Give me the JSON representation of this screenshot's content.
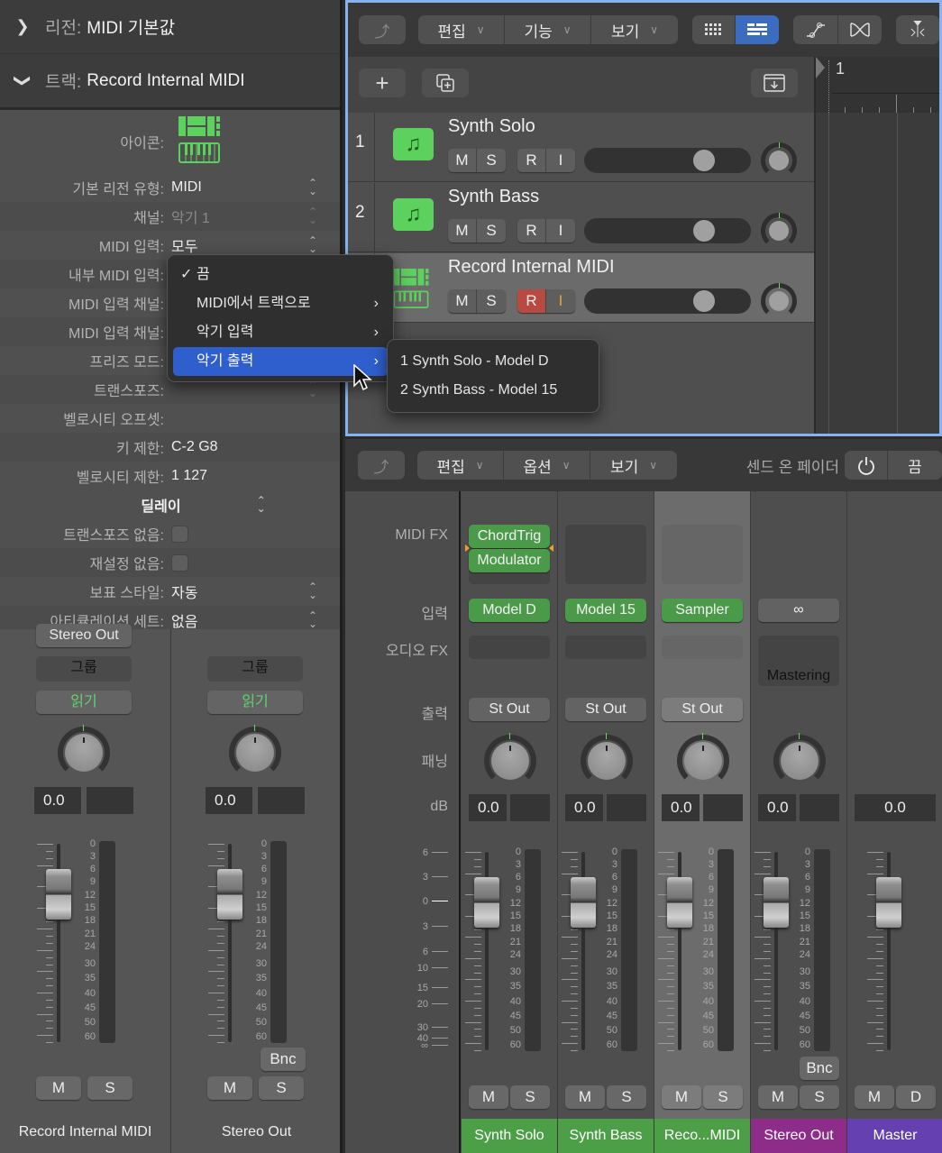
{
  "inspector": {
    "region_header": {
      "label": "리전:",
      "value": "MIDI 기본값",
      "chevron": "chevron-right-icon"
    },
    "track_header": {
      "label": "트랙:",
      "value": "Record Internal MIDI",
      "chevron": "chevron-down-icon"
    },
    "icon_label": "아이콘:",
    "rows": [
      {
        "label": "기본 리전 유형:",
        "value": "MIDI",
        "stepper": true
      },
      {
        "label": "채널:",
        "value": "악기 1",
        "stepper": true,
        "dim": true
      },
      {
        "label": "MIDI 입력:",
        "value": "모두",
        "stepper": true
      },
      {
        "label": "내부 MIDI 입력:",
        "value": ""
      },
      {
        "label": "MIDI 입력 채널:",
        "value": ""
      },
      {
        "label": "MIDI 입력 채널:",
        "value": ""
      },
      {
        "label": "프리즈 모드:",
        "value": ""
      },
      {
        "label": "트랜스포즈:",
        "value": "",
        "stepper": true,
        "dim": true
      },
      {
        "label": "벨로시티 오프셋:",
        "value": ""
      },
      {
        "label": "키 제한:",
        "value": "C-2  G8"
      },
      {
        "label": "벨로시티 제한:",
        "value": "1   127"
      }
    ],
    "delay_label": "딜레이",
    "checkbox_rows": [
      {
        "label": "트랜스포즈 없음:",
        "checked": false
      },
      {
        "label": "재설정 없음:",
        "checked": false
      }
    ],
    "bottom_rows": [
      {
        "label": "보표 스타일:",
        "value": "자동"
      },
      {
        "label": "아티큘레이션 세트:",
        "value": "없음"
      }
    ],
    "strips": [
      {
        "output": "Stereo Out",
        "group": "그룹",
        "automation": "읽기",
        "volume": "0.0",
        "peak": "",
        "mute": "M",
        "solo": "S",
        "bounce": "",
        "name": "Record Internal MIDI",
        "fader_db": 0
      },
      {
        "output": "",
        "group": "그룹",
        "automation": "읽기",
        "volume": "0.0",
        "peak": "",
        "mute": "M",
        "solo": "S",
        "bounce": "Bnc",
        "name": "Stereo Out",
        "fader_db": 0
      }
    ],
    "meter_scale": [
      "0",
      "3",
      "6",
      "9",
      "12",
      "15",
      "18",
      "21",
      "24",
      "30",
      "35",
      "40",
      "45",
      "50",
      "60"
    ]
  },
  "popup_menu": {
    "items": [
      {
        "label": "끔",
        "checked": true,
        "submenu": false
      },
      {
        "label": "MIDI에서 트랙으로",
        "checked": false,
        "submenu": true
      },
      {
        "label": "악기 입력",
        "checked": false,
        "submenu": true
      },
      {
        "label": "악기 출력",
        "checked": false,
        "submenu": true,
        "highlighted": true
      }
    ],
    "check_glyph": "✓",
    "submenu_glyph": "›",
    "submenu_items": [
      "1 Synth Solo - Model D",
      "2 Synth Bass - Model 15"
    ]
  },
  "tracks": {
    "toolbar": {
      "back_icon": "back-arrow-icon",
      "menus": [
        "편집",
        "기능",
        "보기"
      ],
      "view_buttons": [
        "grid-view-icon",
        "list-view-icon"
      ],
      "active_view": 1,
      "tools": [
        "automation-icon",
        "flex-icon"
      ],
      "snap_icon": "catch-playhead-icon"
    },
    "add_track_icon": "plus-icon",
    "duplicate_track_icon": "duplicate-icon",
    "download_icon": "download-icon",
    "ruler_bar": "1",
    "list": [
      {
        "number": "1",
        "name": "Synth Solo",
        "icon": "music-note-icon",
        "mute": "M",
        "solo": "S",
        "rec": "R",
        "input": "I",
        "rec_on": false,
        "selected": false,
        "volume_fraction": 0.75
      },
      {
        "number": "2",
        "name": "Synth Bass",
        "icon": "music-note-icon",
        "mute": "M",
        "solo": "S",
        "rec": "R",
        "input": "I",
        "rec_on": false,
        "selected": false,
        "volume_fraction": 0.75
      },
      {
        "number": "",
        "name": "Record Internal MIDI",
        "icon": "keyboard-icon",
        "mute": "M",
        "solo": "S",
        "rec": "R",
        "input": "I",
        "rec_on": true,
        "selected": true,
        "volume_fraction": 0.75
      }
    ]
  },
  "mixer": {
    "toolbar": {
      "menus": [
        "편집",
        "옵션",
        "보기"
      ],
      "sends_label": "센드 온 페이더",
      "power_icon": "power-icon",
      "sends_value": "끔"
    },
    "row_labels": {
      "midi_fx": "MIDI FX",
      "input": "입력",
      "audio_fx": "오디오 FX",
      "output": "출력",
      "pan": "패닝",
      "db": "dB"
    },
    "gain_scale": [
      "6",
      "3",
      "0",
      "3",
      "6",
      "10",
      "15",
      "20",
      "30",
      "40",
      "∞"
    ],
    "meter_scale": [
      "0",
      "3",
      "6",
      "9",
      "12",
      "15",
      "18",
      "21",
      "24",
      "30",
      "35",
      "40",
      "45",
      "50",
      "60"
    ],
    "strips": [
      {
        "midi_fx": [
          "ChordTrig",
          "Modulator"
        ],
        "input": "Model D",
        "input_green": true,
        "audio_fx": "",
        "output": "St Out",
        "volume": "0.0",
        "peak": "",
        "mute": "M",
        "solo": "S",
        "bounce": "",
        "name": "Synth Solo",
        "color": "#4c9e47",
        "selected": false
      },
      {
        "midi_fx": [],
        "input": "Model 15",
        "input_green": true,
        "audio_fx": "",
        "output": "St Out",
        "volume": "0.0",
        "peak": "",
        "mute": "M",
        "solo": "S",
        "bounce": "",
        "name": "Synth Bass",
        "color": "#4c9e47",
        "selected": false
      },
      {
        "midi_fx": [],
        "input": "Sampler",
        "input_green": true,
        "audio_fx": "",
        "output": "St Out",
        "volume": "0.0",
        "peak": "",
        "mute": "M",
        "solo": "S",
        "bounce": "",
        "name": "Reco...MIDI",
        "color": "#4c9e47",
        "selected": true
      },
      {
        "midi_fx": null,
        "input": "∞",
        "input_green": false,
        "audio_fx": "Mastering",
        "output": "",
        "volume": "0.0",
        "peak": "",
        "mute": "M",
        "solo": "S",
        "bounce": "Bnc",
        "name": "Stereo Out",
        "color": "#8e2c8a",
        "selected": false
      },
      {
        "midi_fx": null,
        "input": "",
        "input_green": false,
        "audio_fx": null,
        "output": "",
        "volume": "0.0",
        "peak": null,
        "mute": "M",
        "solo": "D",
        "bounce": "",
        "name": "Master",
        "color": "#6540b0",
        "selected": false
      }
    ]
  }
}
